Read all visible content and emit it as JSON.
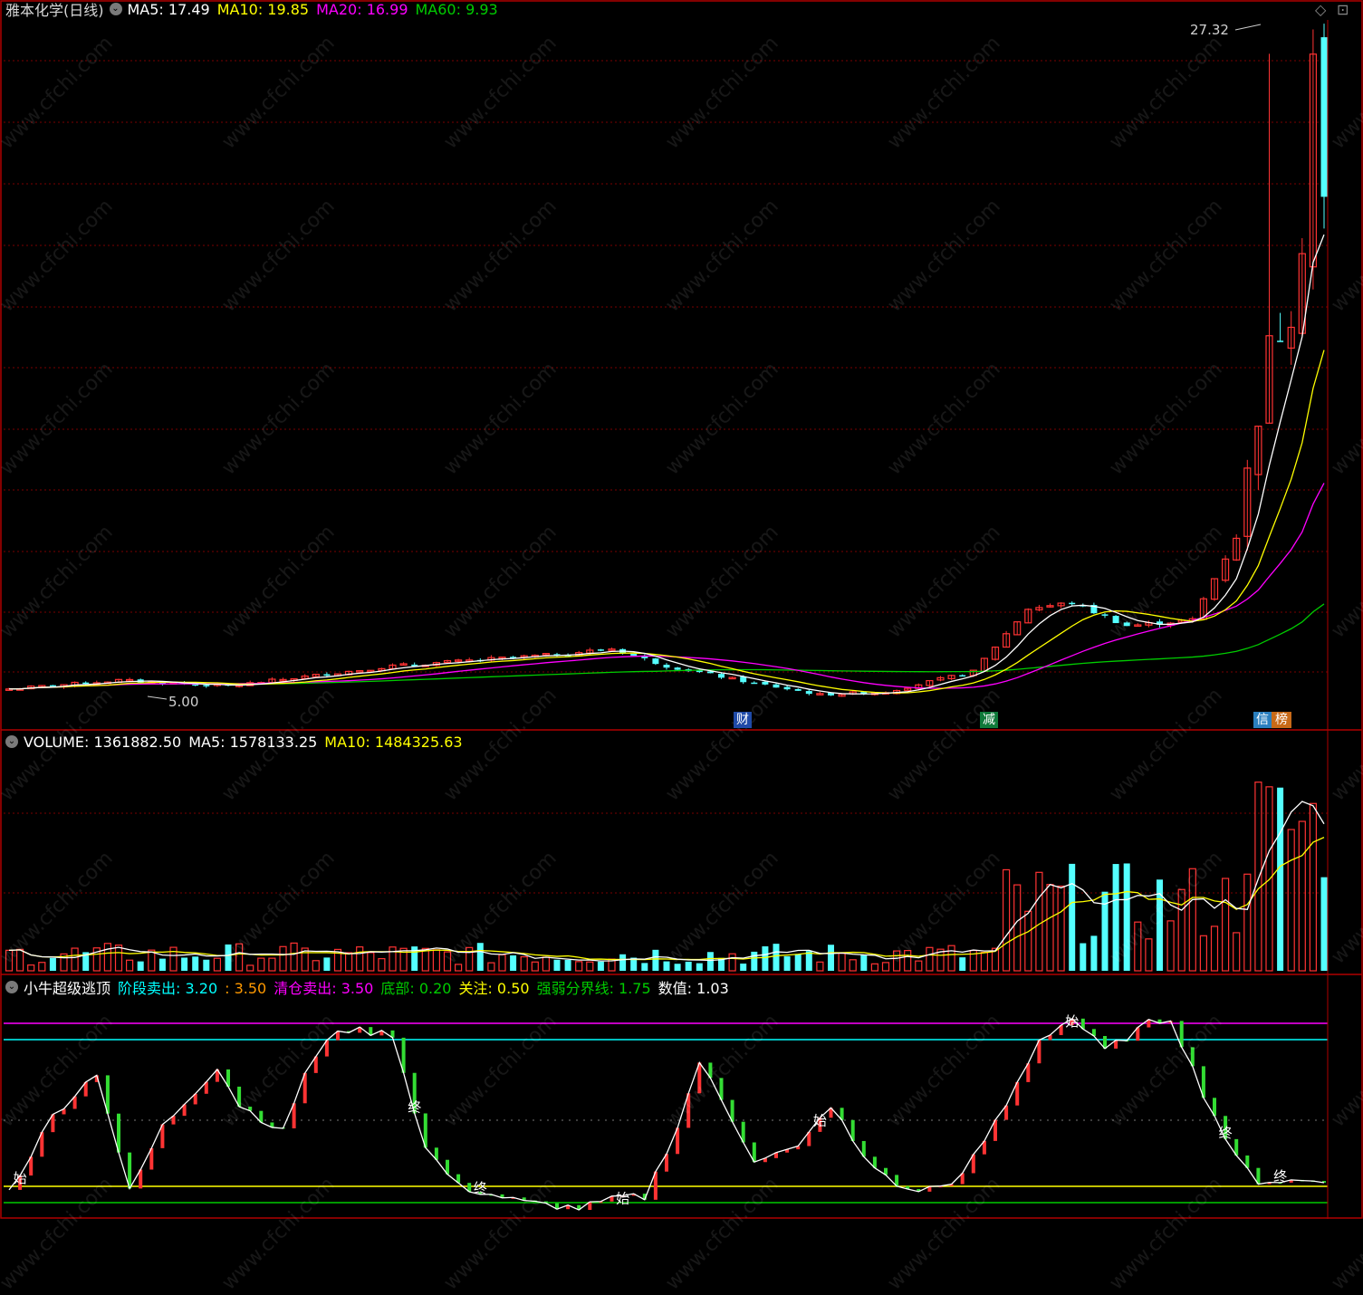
{
  "price_panel": {
    "name": "雅本化学(日线)",
    "ma_labels": [
      {
        "text": "MA5: 17.49",
        "color": "#ffffff"
      },
      {
        "text": "MA10: 19.85",
        "color": "#ffff00"
      },
      {
        "text": "MA20: 16.99",
        "color": "#ff00ff"
      },
      {
        "text": "MA60: 9.93",
        "color": "#00cc00"
      }
    ],
    "high_label": "27.32",
    "low_label": "5.00",
    "event_tags": [
      {
        "text": "财",
        "bg": "#1f4aa8"
      },
      {
        "text": "减",
        "bg": "#0f7a3a"
      },
      {
        "text": "信",
        "bg": "#2a7fbf"
      },
      {
        "text": "榜",
        "bg": "#c86a18"
      }
    ]
  },
  "volume_panel": {
    "labels": [
      {
        "text": "VOLUME: 1361882.50",
        "color": "#ffffff"
      },
      {
        "text": "MA5: 1578133.25",
        "color": "#ffffff"
      },
      {
        "text": "MA10: 1484325.63",
        "color": "#ffff00"
      }
    ]
  },
  "indicator_panel": {
    "labels": [
      {
        "text": "小牛超级逃顶",
        "color": "#ffffff"
      },
      {
        "text": "阶段卖出: 3.20",
        "color": "#00ffff"
      },
      {
        "text": ": 3.50",
        "color": "#ff9900"
      },
      {
        "text": "清仓卖出: 3.50",
        "color": "#ff00ff"
      },
      {
        "text": "底部: 0.20",
        "color": "#00cc00"
      },
      {
        "text": "关注: 0.50",
        "color": "#ffff00"
      },
      {
        "text": "强弱分界线: 1.75",
        "color": "#00cc00"
      },
      {
        "text": "数值: 1.03",
        "color": "#ffffff"
      }
    ],
    "markers": {
      "start": "始",
      "end": "终"
    }
  },
  "watermark": "www.cfchi.com",
  "colors": {
    "up": "#ff3333",
    "down": "#54ffff",
    "ma5": "#ffffff",
    "ma10": "#ffff00",
    "ma20": "#ff00ff",
    "ma60": "#00cc00",
    "grid": "#7a0000",
    "panel_border": "#b00000"
  },
  "chart_data": {
    "type": "candlestick",
    "title": "雅本化学(日线)",
    "price_high_marker": 27.32,
    "price_low_marker": 5.0,
    "price_range": [
      4.5,
      28.5
    ],
    "bars_approx": 121,
    "key_closes": [
      {
        "segment": "start",
        "close": 5.2
      },
      {
        "segment": "first_rise_peak",
        "close": 6.6
      },
      {
        "segment": "trough",
        "close": 5.0
      },
      {
        "segment": "mid_plateau",
        "close": 8.0
      },
      {
        "segment": "breakout",
        "close": 12.5
      },
      {
        "segment": "peak",
        "close": 27.32
      },
      {
        "segment": "last",
        "close": 19.5
      }
    ],
    "moving_averages_last": {
      "MA5": 17.49,
      "MA10": 19.85,
      "MA20": 16.99,
      "MA60": 9.93
    },
    "volume_last": {
      "VOLUME": 1361882.5,
      "MA5": 1578133.25,
      "MA10": 1484325.63
    },
    "indicator_levels": {
      "阶段卖出": 3.2,
      "清仓卖出": 3.5,
      "底部": 0.2,
      "关注": 0.5,
      "强弱分界线": 1.75,
      "数值": 1.03
    }
  }
}
